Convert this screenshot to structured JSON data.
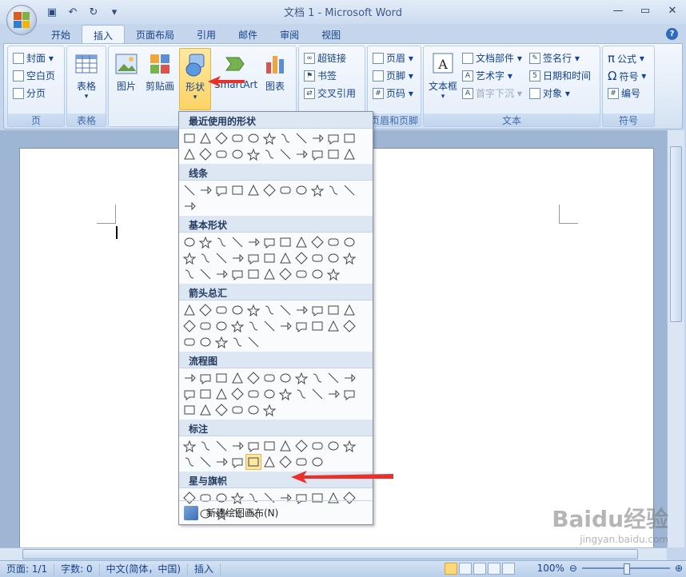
{
  "window": {
    "title": "文档 1 - Microsoft Word"
  },
  "tabs": [
    "开始",
    "插入",
    "页面布局",
    "引用",
    "邮件",
    "审阅",
    "视图"
  ],
  "active_tab_index": 1,
  "ribbon": {
    "page_group": {
      "label": "页",
      "items": [
        "封面",
        "空白页",
        "分页"
      ]
    },
    "table_group": {
      "label": "表格",
      "button": "表格"
    },
    "illustrations": {
      "picture": "图片",
      "clipart": "剪贴画",
      "shapes": "形状",
      "smartart": "SmartArt",
      "chart": "图表"
    },
    "links": {
      "hyperlink": "超链接",
      "bookmark": "书签",
      "crossref": "交叉引用"
    },
    "header_footer": {
      "label": "页眉和页脚",
      "header": "页眉",
      "footer": "页脚",
      "page_number": "页码"
    },
    "text": {
      "label": "文本",
      "textbox": "文本框",
      "quickparts": "文档部件",
      "wordart": "艺术字",
      "dropcap": "首字下沉",
      "signature": "签名行",
      "datetime": "日期和时间",
      "object": "对象"
    },
    "symbols": {
      "label": "符号",
      "equation": "公式",
      "symbol": "符号",
      "number": "编号"
    }
  },
  "shapes_menu": {
    "sections": [
      {
        "title": "最近使用的形状",
        "count": 22
      },
      {
        "title": "线条",
        "count": 12
      },
      {
        "title": "基本形状",
        "count": 32
      },
      {
        "title": "箭头总汇",
        "count": 27
      },
      {
        "title": "流程图",
        "count": 28
      },
      {
        "title": "标注",
        "count": 20
      },
      {
        "title": "星与旗帜",
        "count": 16
      }
    ],
    "new_canvas": "新建绘图画布(N)"
  },
  "statusbar": {
    "page": "页面: 1/1",
    "words": "字数: 0",
    "language": "中文(简体，中国)",
    "mode": "插入",
    "zoom": "100%"
  },
  "watermark": {
    "main": "Baidu经验",
    "sub": "jingyan.baidu.com"
  }
}
